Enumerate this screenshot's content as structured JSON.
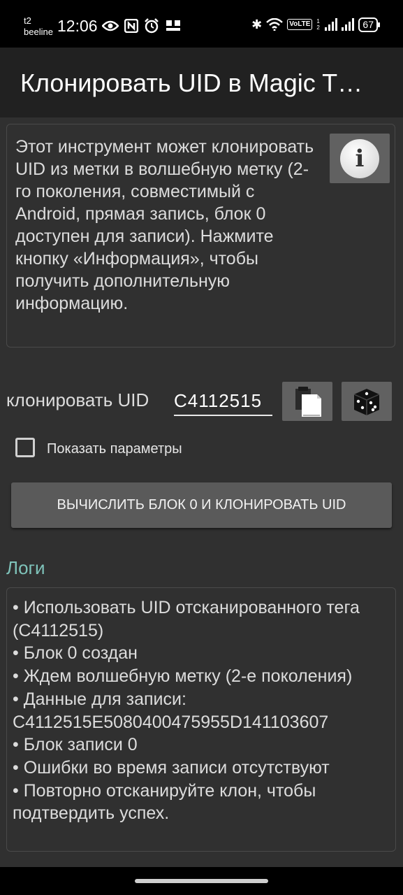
{
  "status_bar": {
    "carrier_top": "t2",
    "carrier_bottom": "beeline",
    "time": "12:06",
    "volte": "VoLTE",
    "volte_index": "1 2",
    "battery": "67"
  },
  "toolbar": {
    "title": "Клонировать UID в Magic T…"
  },
  "description": {
    "text": "Этот инструмент может клонировать UID из метки в волшебную метку (2-го поколения, совместимый с Android, прямая запись, блок 0 доступен для записи). Нажмите кнопку «Информация», чтобы получить дополнительную информацию.",
    "info_icon": "info-icon"
  },
  "uid_row": {
    "label": "клонировать UID",
    "value": "C4112515",
    "paste_icon": "paste-icon",
    "dice_icon": "dice-icon"
  },
  "options": {
    "show_params_label": "Показать параметры",
    "show_params_checked": false
  },
  "actions": {
    "main_button_label": "ВЫЧИСЛИТЬ БЛОК 0 И КЛОНИРОВАТЬ UID"
  },
  "logs": {
    "header": "Логи",
    "lines": [
      "• Использовать UID отсканированного тега (C4112515)",
      "• Блок 0 создан",
      "• Ждем волшебную метку (2-е поколения)",
      "• Данные для записи: C4112515E5080400475955D141103607",
      "• Блок записи 0",
      "• Ошибки во время записи отсутствуют",
      "• Повторно отсканируйте клон, чтобы подтвердить успех."
    ]
  },
  "colors": {
    "background": "#303030",
    "toolbar": "#212121",
    "button": "#5a5a5a",
    "accent": "#7fc3ba"
  }
}
